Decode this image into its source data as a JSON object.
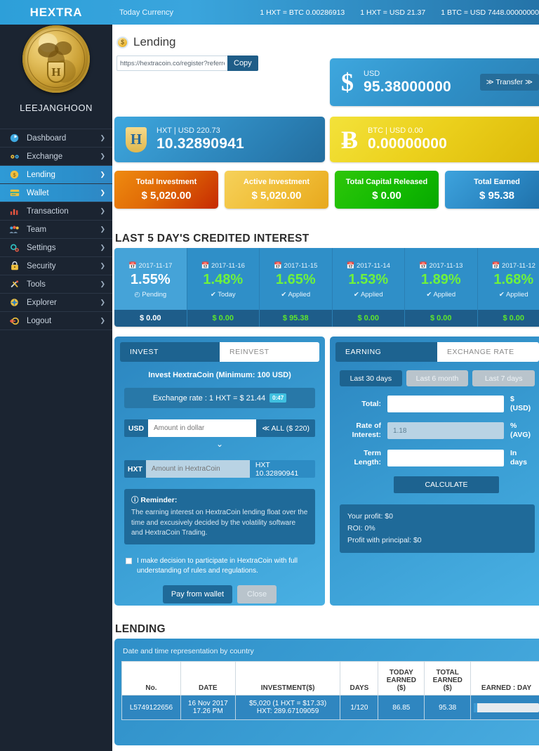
{
  "topbar": {
    "brand": "HEXTRA",
    "today_currency": "Today Currency",
    "rates": [
      "1 HXT = BTC 0.00286913",
      "1 HXT = USD 21.37",
      "1 BTC = USD 7448.00000000"
    ]
  },
  "sidebar": {
    "logo_letter": "H",
    "username": "LEEJANGHOON",
    "items": [
      {
        "label": "Dashboard",
        "icon": "dashboard-icon",
        "glyph": "◔",
        "active": false,
        "caret": "❯"
      },
      {
        "label": "Exchange",
        "icon": "exchange-icon",
        "glyph": "⚯",
        "active": false,
        "caret": "❯"
      },
      {
        "label": "Lending",
        "icon": "lending-coin-icon",
        "glyph": "◎",
        "active": true,
        "caret": "❯"
      },
      {
        "label": "Wallet",
        "icon": "wallet-icon",
        "glyph": "▭",
        "active": true,
        "caret": "❯"
      },
      {
        "label": "Transaction",
        "icon": "bar-chart-icon",
        "glyph": "█",
        "active": false,
        "caret": "❯"
      },
      {
        "label": "Team",
        "icon": "team-icon",
        "glyph": "♟",
        "active": false,
        "caret": "❯"
      },
      {
        "label": "Settings",
        "icon": "gear-icon",
        "glyph": "⚙",
        "active": false,
        "caret": "❯"
      },
      {
        "label": "Security",
        "icon": "lock-icon",
        "glyph": "ὑ2",
        "active": false,
        "caret": "❯"
      },
      {
        "label": "Tools",
        "icon": "tools-icon",
        "glyph": "⚒",
        "active": false,
        "caret": "❯"
      },
      {
        "label": "Explorer",
        "icon": "explorer-icon",
        "glyph": "✷",
        "active": false,
        "caret": "❯"
      },
      {
        "label": "Logout",
        "icon": "logout-icon",
        "glyph": "↩",
        "active": false,
        "caret": "❯"
      }
    ]
  },
  "page": {
    "title": "Lending",
    "referral_url": "https://hextracoin.co/register?referre",
    "copy_label": "Copy"
  },
  "wallets": {
    "usd": {
      "icon": "dollar-icon",
      "symbol": "$",
      "label": "USD",
      "value": "95.38000000",
      "transfer_label": "≫ Transfer ≫"
    },
    "hxt": {
      "icon": "hxt-shield-icon",
      "symbol": "H",
      "label": "HXT | USD 220.73",
      "value": "10.32890941"
    },
    "btc": {
      "icon": "bitcoin-icon",
      "symbol": "Ƀ",
      "label": "BTC | USD 0.00",
      "value": "0.00000000"
    }
  },
  "summary": [
    {
      "title": "Total Investment",
      "value": "$ 5,020.00",
      "color": "#e06a06"
    },
    {
      "title": "Active Investment",
      "value": "$ 5,020.00",
      "color": "#f0bd36"
    },
    {
      "title": "Total Capital Released",
      "value": "$ 0.00",
      "color": "#14bb02"
    },
    {
      "title": "Total Earned",
      "value": "$ 95.38",
      "color": "#2a86c2"
    }
  ],
  "interest": {
    "title": "LAST 5 DAY'S CREDITED INTEREST",
    "days": [
      {
        "date": "2017-11-17",
        "percent": "1.55%",
        "status": "Pending",
        "status_icon": "clock-icon",
        "amount": "$ 0.00",
        "highlight": true
      },
      {
        "date": "2017-11-16",
        "percent": "1.48%",
        "status": "Today",
        "status_icon": "check-icon",
        "amount": "$ 0.00",
        "highlight": false
      },
      {
        "date": "2017-11-15",
        "percent": "1.65%",
        "status": "Applied",
        "status_icon": "check-icon",
        "amount": "$ 95.38",
        "highlight": false
      },
      {
        "date": "2017-11-14",
        "percent": "1.53%",
        "status": "Applied",
        "status_icon": "check-icon",
        "amount": "$ 0.00",
        "highlight": false
      },
      {
        "date": "2017-11-13",
        "percent": "1.89%",
        "status": "Applied",
        "status_icon": "check-icon",
        "amount": "$ 0.00",
        "highlight": false
      },
      {
        "date": "2017-11-12",
        "percent": "1.68%",
        "status": "Applied",
        "status_icon": "check-icon",
        "amount": "$ 0.00",
        "highlight": false
      }
    ]
  },
  "invest_panel": {
    "tab_invest": "INVEST",
    "tab_reinvest": "REINVEST",
    "heading": "Invest HextraCoin (Minimum: 100 USD)",
    "exchange_rate_text": "Exchange rate : 1 HXT = $ 21.44",
    "countdown": "0:47",
    "usd_tag": "USD",
    "usd_placeholder": "Amount in dollar",
    "all_button": "≪ ALL ($ 220)",
    "hxt_tag": "HXT",
    "hxt_placeholder": "Amount in HextraCoin",
    "hxt_balance": "HXT 10.32890941",
    "reminder_title": "Reminder:",
    "reminder_text": "The earning interest on HextraCoin lending float over the time and excusively decided by the volatility software and HextraCoin Trading.",
    "agree_text": "I make decision to participate in HextraCoin with full understanding of rules and regulations.",
    "pay_label": "Pay from wallet",
    "close_label": "Close"
  },
  "earning_panel": {
    "tab_earning": "EARNING",
    "tab_exchange_rate": "EXCHANGE RATE",
    "periods": [
      {
        "label": "Last 30 days",
        "active": true
      },
      {
        "label": "Last 6 month",
        "active": false
      },
      {
        "label": "Last 7 days",
        "active": false
      }
    ],
    "fields": [
      {
        "label": "Total:",
        "value": "",
        "unit": "$ (USD)",
        "disabled": false
      },
      {
        "label": "Rate of Interest:",
        "value": "1.18",
        "unit": "% (AVG)",
        "disabled": true
      },
      {
        "label": "Term Length:",
        "value": "",
        "unit": "In days",
        "disabled": false
      }
    ],
    "calculate_label": "CALCULATE",
    "results": [
      "Your profit: $0",
      "ROI: 0%",
      "Profit with principal: $0"
    ]
  },
  "lending_table": {
    "title": "LENDING",
    "caption": "Date and time representation by country",
    "headers": [
      "No.",
      "DATE",
      "INVESTMENT($)",
      "DAYS",
      "TODAY EARNED ($)",
      "TOTAL EARNED ($)",
      "EARNED : DAY"
    ],
    "rows": [
      {
        "no": "L5749122656",
        "date_line1": "16 Nov 2017",
        "date_line2": "17.26 PM",
        "investment_line1": "$5,020 (1 HXT = $17.33)",
        "investment_line2": "HXT: 289.67109059",
        "days": "1/120",
        "today_earned": "86.85",
        "total_earned": "95.38",
        "progress_percent": 5
      }
    ]
  }
}
